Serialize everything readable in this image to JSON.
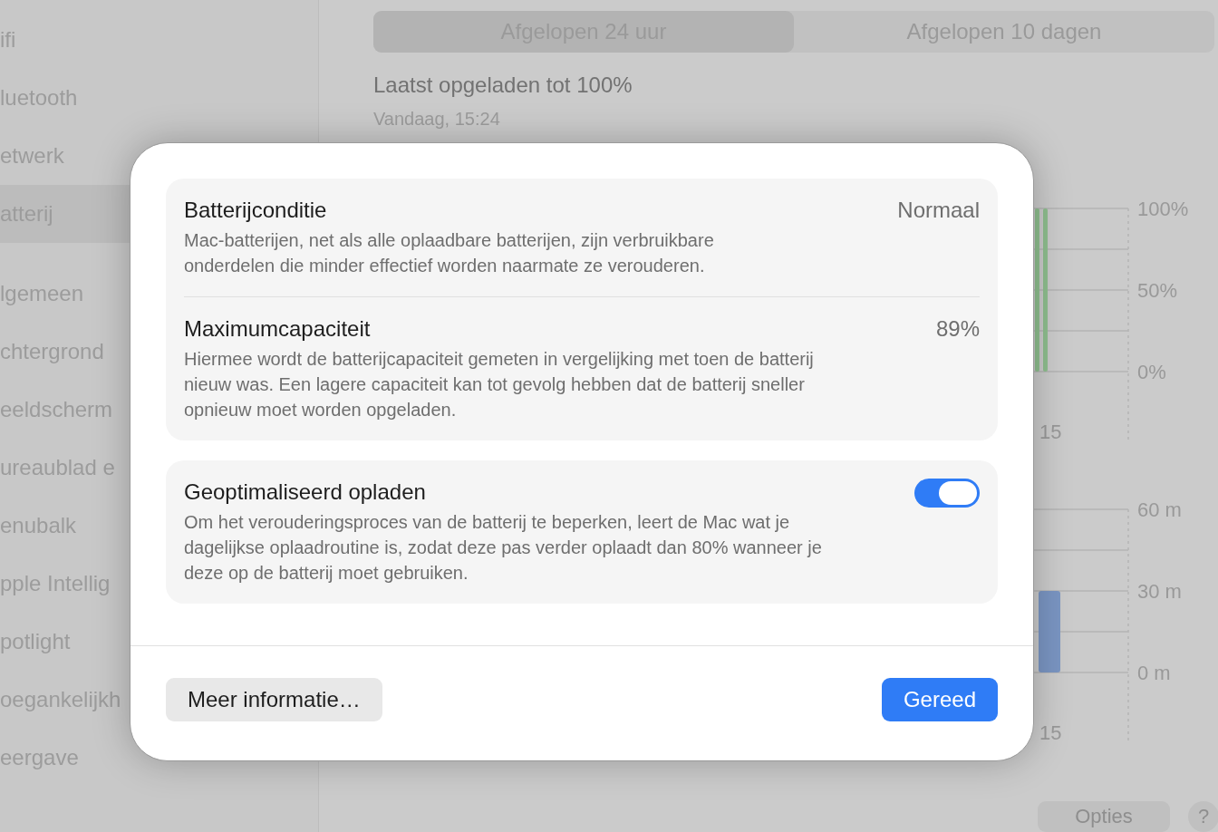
{
  "sidebar": {
    "items": [
      {
        "label": "ifi",
        "selected": false
      },
      {
        "label": "luetooth",
        "selected": false
      },
      {
        "label": "etwerk",
        "selected": false
      },
      {
        "label": "atterij",
        "selected": true
      },
      {
        "label": "lgemeen",
        "selected": false
      },
      {
        "label": "chtergrond",
        "selected": false
      },
      {
        "label": "eeldscherm",
        "selected": false
      },
      {
        "label": "ureaublad e",
        "selected": false
      },
      {
        "label": "enubalk",
        "selected": false
      },
      {
        "label": "pple Intellig",
        "selected": false
      },
      {
        "label": "potlight",
        "selected": false
      },
      {
        "label": "oegankelijkh",
        "selected": false
      },
      {
        "label": "eergave",
        "selected": false
      }
    ]
  },
  "segments": [
    {
      "label": "Afgelopen 24 uur",
      "selected": true
    },
    {
      "label": "Afgelopen 10 dagen",
      "selected": false
    }
  ],
  "last_charged": {
    "title": "Laatst opgeladen tot 100%",
    "time": "Vandaag, 15:24"
  },
  "level_chart": {
    "y_labels": [
      "100%",
      "50%",
      "0%"
    ],
    "x_label": "15"
  },
  "usage_chart": {
    "y_labels": [
      "60 m",
      "30 m",
      "0 m"
    ],
    "x_label": "15"
  },
  "footer_buttons": [
    "Opties",
    "?"
  ],
  "dialog": {
    "groups": [
      {
        "rows": [
          {
            "kind": "value",
            "title": "Batterijconditie",
            "value": "Normaal",
            "description": "Mac-batterijen, net als alle oplaadbare batterijen, zijn verbruikbare onderdelen die minder effectief worden naarmate ze verouderen."
          },
          {
            "kind": "value",
            "title": "Maximumcapaciteit",
            "value": "89%",
            "description": "Hiermee wordt de batterijcapaciteit gemeten in vergelijking met toen de batterij nieuw was. Een lagere capaciteit kan tot gevolg hebben dat de batterij sneller opnieuw moet worden opgeladen."
          }
        ]
      },
      {
        "rows": [
          {
            "kind": "toggle",
            "title": "Geoptimaliseerd opladen",
            "on": true,
            "description": "Om het verouderingsproces van de batterij te beperken, leert de Mac wat je dagelijkse oplaadroutine is, zodat deze pas verder oplaadt dan 80% wanneer je deze op de batterij moet gebruiken."
          }
        ]
      }
    ],
    "buttons": [
      {
        "label": "Meer informatie…",
        "kind": "secondary"
      },
      {
        "label": "Gereed",
        "kind": "primary"
      }
    ]
  }
}
